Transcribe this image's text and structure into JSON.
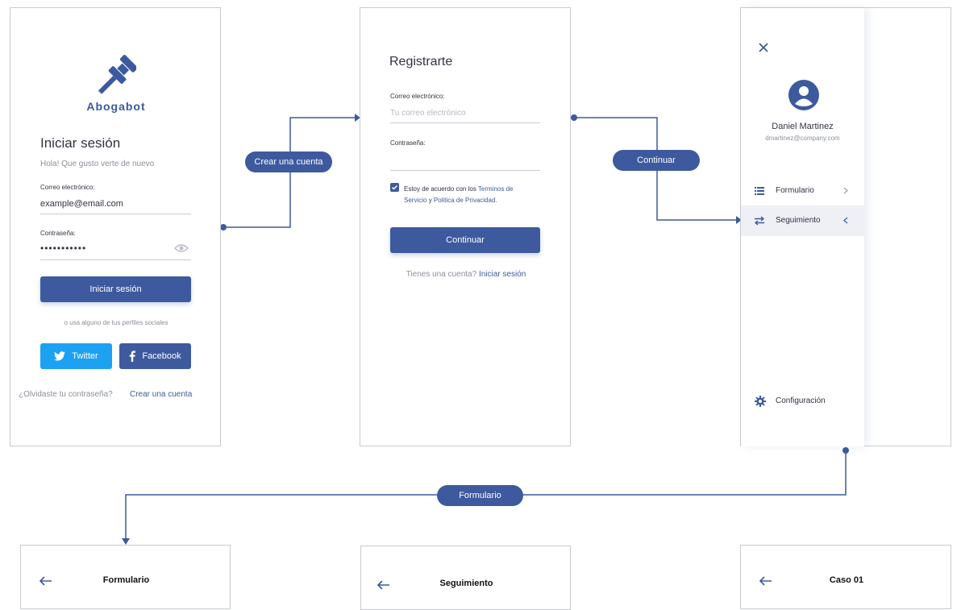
{
  "colors": {
    "brand": "#3d5a9e",
    "twitter": "#1da1f2",
    "facebook": "#3d5a9e",
    "border": "#c8cbd2"
  },
  "connectors": {
    "create_account": "Crear una cuenta",
    "continue": "Continuar",
    "form": "Formulario"
  },
  "login": {
    "brand": "Abogabot",
    "title": "Iniciar sesión",
    "subtitle": "Hola! Que gusto verte de nuevo",
    "email_label": "Correo electrónico:",
    "email_value": "example@email.com",
    "password_label": "Contraseña:",
    "password_value": "•••••••••••",
    "submit": "Iniciar sesión",
    "social_text": "o usa alguno de tus perfiles sociales",
    "twitter": "Twitter",
    "facebook": "Facebook",
    "forgot": "¿Olvidaste tu contraseña?",
    "create": "Crear una cuenta",
    "icons": [
      "gavel-icon",
      "eye-icon",
      "twitter-icon",
      "facebook-icon"
    ]
  },
  "register": {
    "title": "Registrarte",
    "email_label": "Correo electrónico:",
    "email_placeholder": "Tu correo electrónico",
    "password_label": "Contraseña:",
    "terms_prefix": "Estoy de acuerdo con los",
    "terms_link1": "Terminos de",
    "terms_link1b": "Servicio",
    "terms_and": "y",
    "terms_link2": "Politica de Privacidad.",
    "submit": "Continuar",
    "have_account": "Tienes una cuenta?",
    "login_link": "Iniciar sesión",
    "terms_checked": true
  },
  "menu": {
    "user_name": "Daniel Martinez",
    "user_email": "dmartinez@company.com",
    "items": [
      {
        "label": "Formulario",
        "icon": "list-icon",
        "active": false
      },
      {
        "label": "Seguimiento",
        "icon": "swap-icon",
        "active": true
      }
    ],
    "settings": "Configuración"
  },
  "bottom_screens": [
    {
      "title": "Formulario"
    },
    {
      "title": "Seguimiento"
    },
    {
      "title": "Caso 01"
    }
  ]
}
